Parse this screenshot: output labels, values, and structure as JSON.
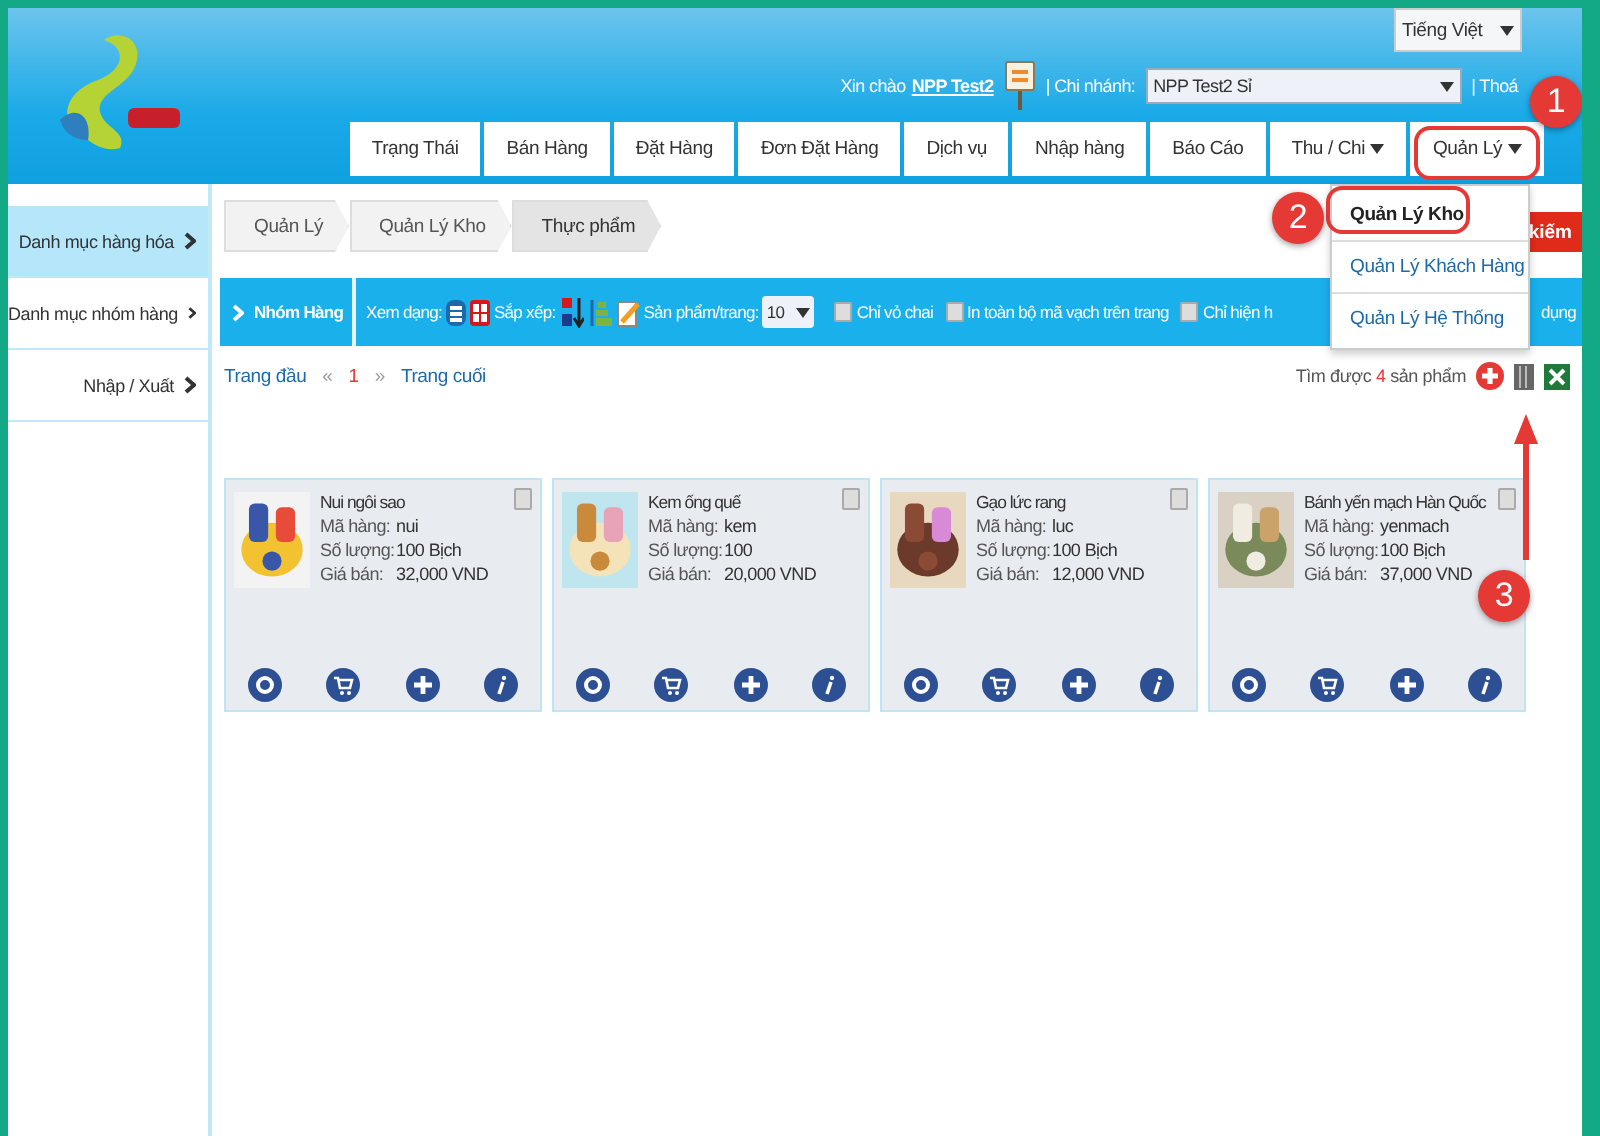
{
  "header": {
    "language": "Tiếng Việt",
    "greeting": "Xin chào",
    "user": "NPP Test2",
    "branch_label": "| Chi nhánh:",
    "branch": "NPP Test2 Sỉ",
    "logout": "| Thoá"
  },
  "nav": [
    {
      "label": "Trạng Thái",
      "dropdown": false,
      "selected": false
    },
    {
      "label": "Bán Hàng",
      "dropdown": false,
      "selected": false
    },
    {
      "label": "Đặt Hàng",
      "dropdown": false,
      "selected": false
    },
    {
      "label": "Đơn Đặt Hàng",
      "dropdown": false,
      "selected": false
    },
    {
      "label": "Dịch vụ",
      "dropdown": false,
      "selected": false
    },
    {
      "label": "Nhập hàng",
      "dropdown": false,
      "selected": false
    },
    {
      "label": "Báo Cáo",
      "dropdown": false,
      "selected": false
    },
    {
      "label": "Thu / Chi",
      "dropdown": true,
      "selected": false
    },
    {
      "label": "Quản Lý",
      "dropdown": true,
      "selected": true
    }
  ],
  "menu": [
    {
      "label": "Quản Lý Kho",
      "selected": true
    },
    {
      "label": "Quản Lý Khách Hàng",
      "selected": false
    },
    {
      "label": "Quản Lý Hệ Thống",
      "selected": false
    }
  ],
  "sidebar": [
    {
      "label": "Danh mục hàng hóa",
      "selected": true
    },
    {
      "label": "Danh mục nhóm hàng",
      "selected": false
    },
    {
      "label": "Nhập / Xuất",
      "selected": false
    }
  ],
  "breadcrumb": [
    "Quản Lý",
    "Quản Lý Kho",
    "Thực phẩm"
  ],
  "search_button": "kiếm",
  "toolbar": {
    "group": "Nhóm Hàng",
    "view_label": "Xem dạng:",
    "sort_label": "Sắp xếp:",
    "per_page_label": "Sản phẩm/trang:",
    "per_page": "10",
    "checks": [
      {
        "label": "Chỉ vỏ chai",
        "checked": false
      },
      {
        "label": "In toàn bộ mã vạch trên trang",
        "checked": false
      },
      {
        "label": "Chỉ hiện h",
        "checked": false
      }
    ],
    "tail": "dụng"
  },
  "pager": {
    "first": "Trang đầu",
    "prev": "«",
    "page": "1",
    "next": "»",
    "last": "Trang cuối"
  },
  "result": {
    "prefix": "Tìm được",
    "count": "4",
    "suffix": "sản phẩm"
  },
  "products": [
    {
      "name": "Nui ngôi sao",
      "checked": false,
      "fields": [
        {
          "label": "Mã hàng:",
          "value": "nui"
        },
        {
          "label": "Số lượng:",
          "value": "100 Bịch"
        },
        {
          "label": "Giá bán:",
          "value": "32,000 VND"
        }
      ]
    },
    {
      "name": "Kem ống quế",
      "checked": false,
      "fields": [
        {
          "label": "Mã hàng:",
          "value": "kem"
        },
        {
          "label": "Số lượng:",
          "value": "100"
        },
        {
          "label": "Giá bán:",
          "value": "20,000 VND"
        }
      ]
    },
    {
      "name": "Gạo lức rang",
      "checked": false,
      "fields": [
        {
          "label": "Mã hàng:",
          "value": "luc"
        },
        {
          "label": "Số lượng:",
          "value": "100 Bịch"
        },
        {
          "label": "Giá bán:",
          "value": "12,000 VND"
        }
      ]
    },
    {
      "name": "Bánh yến mạch Hàn Quốc",
      "checked": false,
      "fields": [
        {
          "label": "Mã hàng:",
          "value": "yenmach"
        },
        {
          "label": "Số lượng:",
          "value": "100 Bịch"
        },
        {
          "label": "Giá bán:",
          "value": "37,000 VND"
        }
      ]
    }
  ],
  "callouts": [
    "1",
    "2",
    "3"
  ]
}
